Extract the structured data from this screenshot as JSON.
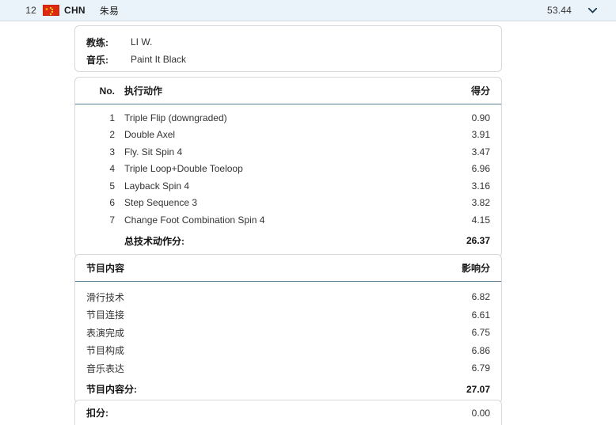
{
  "header": {
    "rank": "12",
    "flag_icon": "flag-china-icon",
    "country": "CHN",
    "athlete": "朱易",
    "total_score": "53.44",
    "expand_icon": "chevron-down-icon"
  },
  "info": {
    "coach_label": "教练:",
    "coach_value": "LI W.",
    "music_label": "音乐:",
    "music_value": "Paint It Black"
  },
  "elements": {
    "head": {
      "no": "No.",
      "name": "执行动作",
      "score": "得分"
    },
    "rows": [
      {
        "no": "1",
        "name": "Triple Flip (downgraded)",
        "score": "0.90"
      },
      {
        "no": "2",
        "name": "Double Axel",
        "score": "3.91"
      },
      {
        "no": "3",
        "name": "Fly. Sit Spin 4",
        "score": "3.47"
      },
      {
        "no": "4",
        "name": "Triple Loop+Double Toeloop",
        "score": "6.96"
      },
      {
        "no": "5",
        "name": "Layback Spin 4",
        "score": "3.16"
      },
      {
        "no": "6",
        "name": "Step Sequence 3",
        "score": "3.82"
      },
      {
        "no": "7",
        "name": "Change Foot Combination Spin 4",
        "score": "4.15"
      }
    ],
    "total_label": "总技术动作分:",
    "total_value": "26.37"
  },
  "components": {
    "head": {
      "name": "节目内容",
      "score": "影响分"
    },
    "rows": [
      {
        "name": "滑行技术",
        "score": "6.82"
      },
      {
        "name": "节目连接",
        "score": "6.61"
      },
      {
        "name": "表演完成",
        "score": "6.75"
      },
      {
        "name": "节目构成",
        "score": "6.86"
      },
      {
        "name": "音乐表达",
        "score": "6.79"
      }
    ],
    "total_label": "节目内容分:",
    "total_value": "27.07"
  },
  "deduction": {
    "label": "扣分:",
    "value": "0.00"
  },
  "colors": {
    "bar_bg": "#eaf3fa",
    "card_border": "#d5d8dc",
    "head_rule": "#5b7f95",
    "flag_red": "#de2910",
    "flag_yellow": "#ffde00"
  }
}
